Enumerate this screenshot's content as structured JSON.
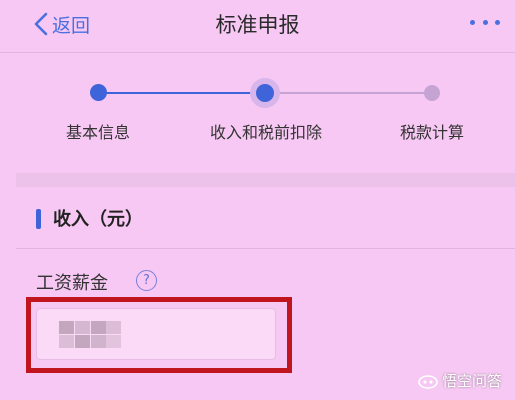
{
  "navbar": {
    "back_label": "返回",
    "title": "标准申报"
  },
  "stepper": {
    "steps": [
      {
        "label": "基本信息",
        "state": "done"
      },
      {
        "label": "收入和税前扣除",
        "state": "current"
      },
      {
        "label": "税款计算",
        "state": "pending"
      }
    ]
  },
  "section": {
    "title": "收入（元）"
  },
  "salary": {
    "label": "工资薪金",
    "help_glyph": "?",
    "value": ""
  },
  "watermark": {
    "text": "悟空问答"
  },
  "colors": {
    "accent": "#3f63d9",
    "background": "#f6c8f3",
    "highlight_frame": "#c0141e"
  }
}
